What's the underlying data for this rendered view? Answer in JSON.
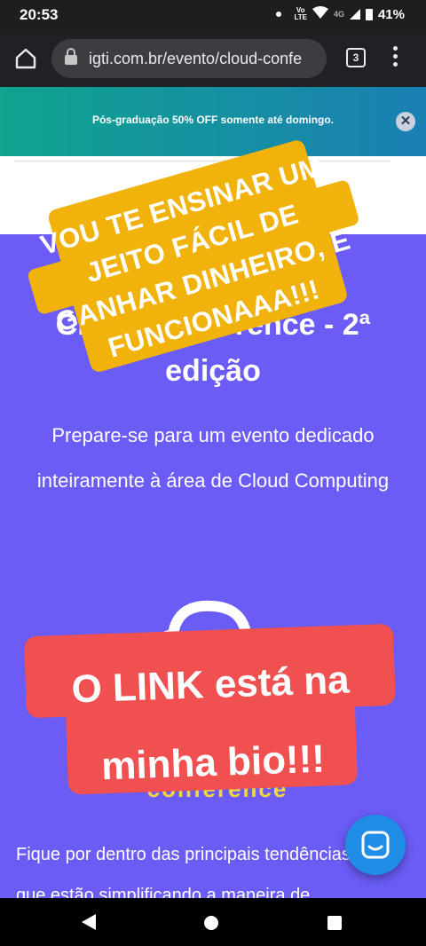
{
  "status_bar": {
    "time": "20:53",
    "volte_line1": "Vo",
    "volte_line2": "LTE",
    "network": "4G",
    "battery": "41%"
  },
  "browser": {
    "url": "igti.com.br/evento/cloud-confe",
    "tab_count": "3"
  },
  "promo": {
    "text": "Pós-graduação 50% OFF somente até domingo.",
    "close_label": "✕"
  },
  "page": {
    "title_lines": [
      "Cloud Conference - 2ª",
      "edição"
    ],
    "subtitle": "Prepare-se para um evento dedicado inteiramente à área de Cloud Computing",
    "logo_caption": "conference",
    "body_line1": "Fique por dentro das principais tendências",
    "body_line2": "que estão simplificando a maneira de"
  },
  "overlays": {
    "yellow_text_lines": [
      "VOU TE ENSINAR UM",
      "JEITO FÁCIL DE",
      "GANHAR DINHEIRO, E",
      "FUNCIONAAA!!!"
    ],
    "red_text_lines": [
      "O LINK está na",
      "minha bio!!!"
    ]
  },
  "colors": {
    "page_bg": "#6a5cf5",
    "promo_gradient_start": "#10a38e",
    "promo_gradient_end": "#1a7fb3",
    "yellow_overlay": "#f2b20c",
    "red_overlay": "#f05050",
    "logo_caption": "#f5d63a",
    "chat_button": "#1f8de6"
  }
}
